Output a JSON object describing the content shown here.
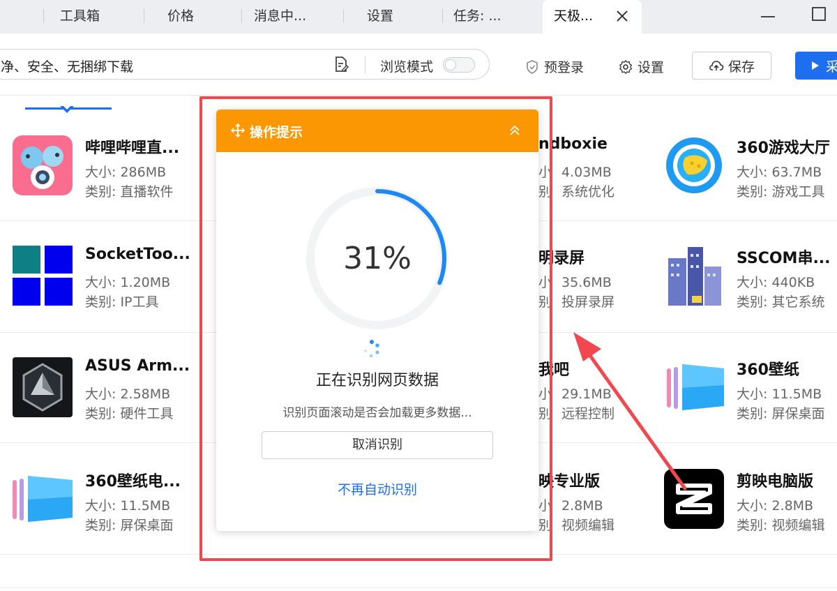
{
  "tabs": [
    {
      "label": "工具箱"
    },
    {
      "label": "价格"
    },
    {
      "label": "消息中..."
    },
    {
      "label": "设置"
    },
    {
      "label": "任务: ..."
    },
    {
      "label": "天极..."
    }
  ],
  "address_bar": {
    "text": "净、安全、无捆绑下载",
    "mode_label": "浏览模式"
  },
  "toolbar": {
    "prelogin_label": "预登录",
    "settings_label": "设置",
    "save_label": "保存",
    "primary_label": "采"
  },
  "apps": [
    {
      "name": "哔哩哔哩直...",
      "size": "大小: 286MB",
      "category": "类别: 直播软件",
      "icon": "bilibili-icon"
    },
    {
      "name": "ndboxie",
      "size": "4.03MB",
      "category": "系统优化",
      "icon": "sandboxie-icon"
    },
    {
      "name": "360游戏大厅",
      "size": "大小: 63.7MB",
      "category": "类别: 游戏工具",
      "icon": "360-game-icon"
    },
    {
      "name": "SocketToo...",
      "size": "大小: 1.20MB",
      "category": "类别: IP工具",
      "icon": "sockettool-icon"
    },
    {
      "name": "明录屏",
      "size": "35.6MB",
      "category": "投屏录屏",
      "icon": "screen-record-icon"
    },
    {
      "name": "SSCOM串...",
      "size": "大小: 440KB",
      "category": "类别: 其它系统",
      "icon": "sscom-icon"
    },
    {
      "name": "ASUS Arm...",
      "size": "大小: 2.58MB",
      "category": "类别: 硬件工具",
      "icon": "asus-armoury-icon"
    },
    {
      "name": "我吧",
      "size": "29.1MB",
      "category": "远程控制",
      "icon": "remote-icon"
    },
    {
      "name": "360壁纸",
      "size": "大小: 11.5MB",
      "category": "类别: 屏保桌面",
      "icon": "360-wallpaper-icon"
    },
    {
      "name": "360壁纸电...",
      "size": "大小: 11.5MB",
      "category": "类别: 屏保桌面",
      "icon": "360-wallpaper-icon"
    },
    {
      "name": "映专业版",
      "size": "2.8MB",
      "category": "视频编辑",
      "icon": "capcut-pro-icon"
    },
    {
      "name": "剪映电脑版",
      "size": "大小: 2.8MB",
      "category": "类别: 视频编辑",
      "icon": "capcut-icon"
    }
  ],
  "partial_prefix": {
    "size": "小",
    "category": "别"
  },
  "popup": {
    "title": "操作提示",
    "progress_text": "31%",
    "progress": 0.31,
    "status": "正在识别网页数据",
    "substatus": "识别页面滚动是否会加载更多数据...",
    "cancel_label": "取消识别",
    "no_auto_label": "不再自动识别"
  },
  "colors": {
    "accent": "#1e6ff0",
    "popup_header": "#fb9703",
    "highlight": "#f0484f",
    "progress": "#1e88f0"
  }
}
